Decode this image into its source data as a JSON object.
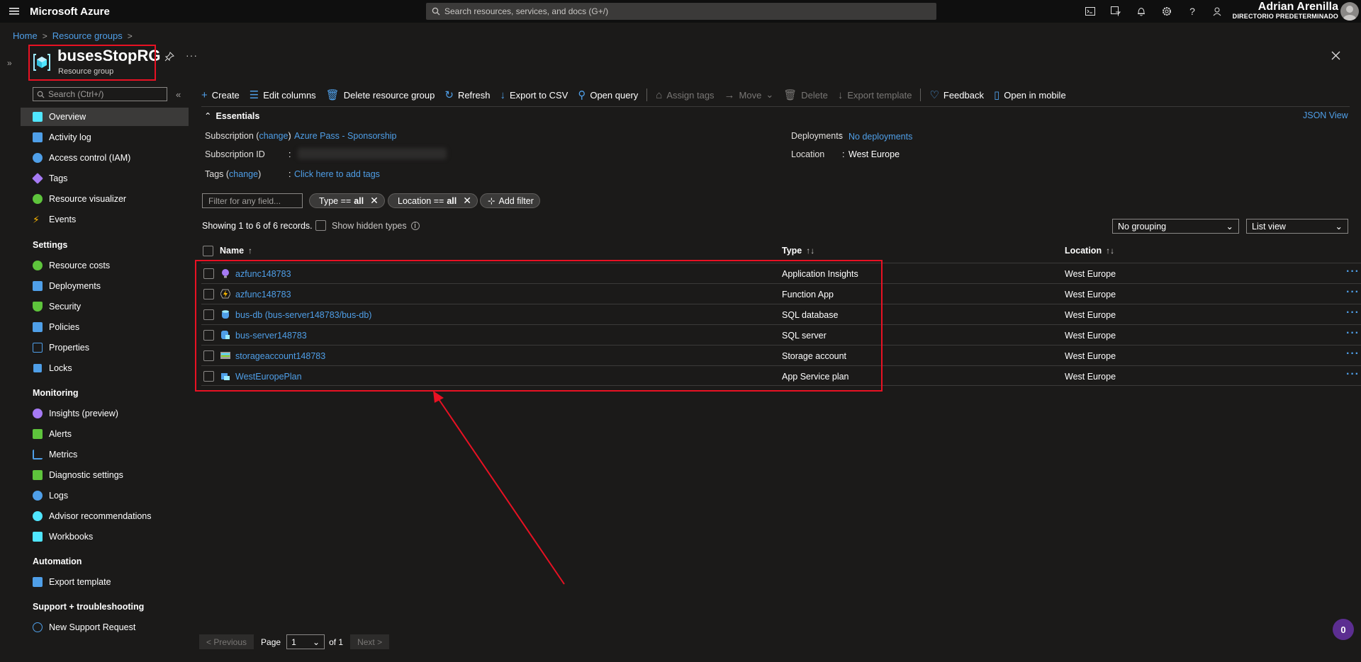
{
  "topbar": {
    "brand": "Microsoft Azure",
    "search_placeholder": "Search resources, services, and docs (G+/)",
    "user_name": "Adrian Arenilla",
    "user_directory": "DIRECTORIO PREDETERMINADO",
    "icons": [
      "cloud-shell-icon",
      "directory-filter-icon",
      "notifications-icon",
      "settings-icon",
      "help-icon",
      "feedback-icon"
    ]
  },
  "breadcrumb": {
    "home": "Home",
    "resource_groups": "Resource groups",
    "separator": ">"
  },
  "header": {
    "title": "busesStopRG",
    "subtitle": "Resource group",
    "more": "···"
  },
  "sidebar": {
    "search_placeholder": "Search (Ctrl+/)",
    "items": [
      {
        "label": "Overview",
        "icon": "overview-icon",
        "color": "#50e6ff"
      },
      {
        "label": "Activity log",
        "icon": "activity-log-icon",
        "color": "#4f9fe8"
      },
      {
        "label": "Access control (IAM)",
        "icon": "iam-icon",
        "color": "#4f9fe8"
      },
      {
        "label": "Tags",
        "icon": "tag-icon",
        "color": "#a67af4"
      },
      {
        "label": "Resource visualizer",
        "icon": "visualizer-icon",
        "color": "#5ec43c"
      },
      {
        "label": "Events",
        "icon": "events-icon",
        "color": "#ffb900"
      }
    ],
    "settings_heading": "Settings",
    "settings_items": [
      {
        "label": "Resource costs",
        "icon": "costs-icon",
        "color": "#5ec43c"
      },
      {
        "label": "Deployments",
        "icon": "deployments-icon",
        "color": "#4f9fe8"
      },
      {
        "label": "Security",
        "icon": "security-icon",
        "color": "#5ec43c"
      },
      {
        "label": "Policies",
        "icon": "policies-icon",
        "color": "#4f9fe8"
      },
      {
        "label": "Properties",
        "icon": "properties-icon",
        "color": "#4f9fe8"
      },
      {
        "label": "Locks",
        "icon": "lock-icon",
        "color": "#4f9fe8"
      }
    ],
    "monitoring_heading": "Monitoring",
    "monitoring_items": [
      {
        "label": "Insights (preview)",
        "icon": "insights-icon",
        "color": "#a67af4"
      },
      {
        "label": "Alerts",
        "icon": "alerts-icon",
        "color": "#5ec43c"
      },
      {
        "label": "Metrics",
        "icon": "metrics-icon",
        "color": "#4f9fe8"
      },
      {
        "label": "Diagnostic settings",
        "icon": "diagnostic-icon",
        "color": "#5ec43c"
      },
      {
        "label": "Logs",
        "icon": "logs-icon",
        "color": "#4f9fe8"
      },
      {
        "label": "Advisor recommendations",
        "icon": "advisor-icon",
        "color": "#50e6ff"
      },
      {
        "label": "Workbooks",
        "icon": "workbooks-icon",
        "color": "#50e6ff"
      }
    ],
    "automation_heading": "Automation",
    "automation_items": [
      {
        "label": "Export template",
        "icon": "export-template-icon",
        "color": "#4f9fe8"
      }
    ],
    "support_heading": "Support + troubleshooting",
    "support_items": [
      {
        "label": "New Support Request",
        "icon": "support-icon",
        "color": "#4f9fe8"
      }
    ]
  },
  "commands": {
    "create": "Create",
    "edit_columns": "Edit columns",
    "delete_rg": "Delete resource group",
    "refresh": "Refresh",
    "export_csv": "Export to CSV",
    "open_query": "Open query",
    "assign_tags": "Assign tags",
    "move": "Move",
    "delete": "Delete",
    "export_template": "Export template",
    "feedback": "Feedback",
    "open_mobile": "Open in mobile"
  },
  "essentials": {
    "heading": "Essentials",
    "json_view": "JSON View",
    "subscription_label": "Subscription",
    "change": "change",
    "subscription_value": "Azure Pass - Sponsorship",
    "subscription_id_label": "Subscription ID",
    "tags_label": "Tags",
    "tags_value": "Click here to add tags",
    "deployments_label": "Deployments",
    "deployments_value": "No deployments",
    "location_label": "Location",
    "location_value": "West Europe"
  },
  "filters": {
    "filter_placeholder": "Filter for any field...",
    "type_filter_key": "Type ==",
    "type_filter_value": "all",
    "location_filter_key": "Location ==",
    "location_filter_value": "all",
    "add_filter": "Add filter",
    "records": "Showing 1 to 6 of 6 records.",
    "show_hidden": "Show hidden types",
    "grouping": "No grouping",
    "view": "List view"
  },
  "table": {
    "columns": {
      "name": "Name",
      "type": "Type",
      "location": "Location"
    },
    "rows": [
      {
        "name": "azfunc148783",
        "type": "Application Insights",
        "location": "West Europe",
        "icon": "app-insights-icon",
        "color": "#a67af4"
      },
      {
        "name": "azfunc148783",
        "type": "Function App",
        "location": "West Europe",
        "icon": "function-app-icon",
        "color": "#ffb900"
      },
      {
        "name": "bus-db (bus-server148783/bus-db)",
        "type": "SQL database",
        "location": "West Europe",
        "icon": "sql-database-icon",
        "color": "#4f9fe8"
      },
      {
        "name": "bus-server148783",
        "type": "SQL server",
        "location": "West Europe",
        "icon": "sql-server-icon",
        "color": "#4f9fe8"
      },
      {
        "name": "storageaccount148783",
        "type": "Storage account",
        "location": "West Europe",
        "icon": "storage-account-icon",
        "color": "#86d633"
      },
      {
        "name": "WestEuropePlan",
        "type": "App Service plan",
        "location": "West Europe",
        "icon": "app-service-plan-icon",
        "color": "#4f9fe8"
      }
    ]
  },
  "pager": {
    "previous": "< Previous",
    "page_label": "Page",
    "page_value": "1",
    "of": "of 1",
    "next": "Next >"
  },
  "badge": "0"
}
